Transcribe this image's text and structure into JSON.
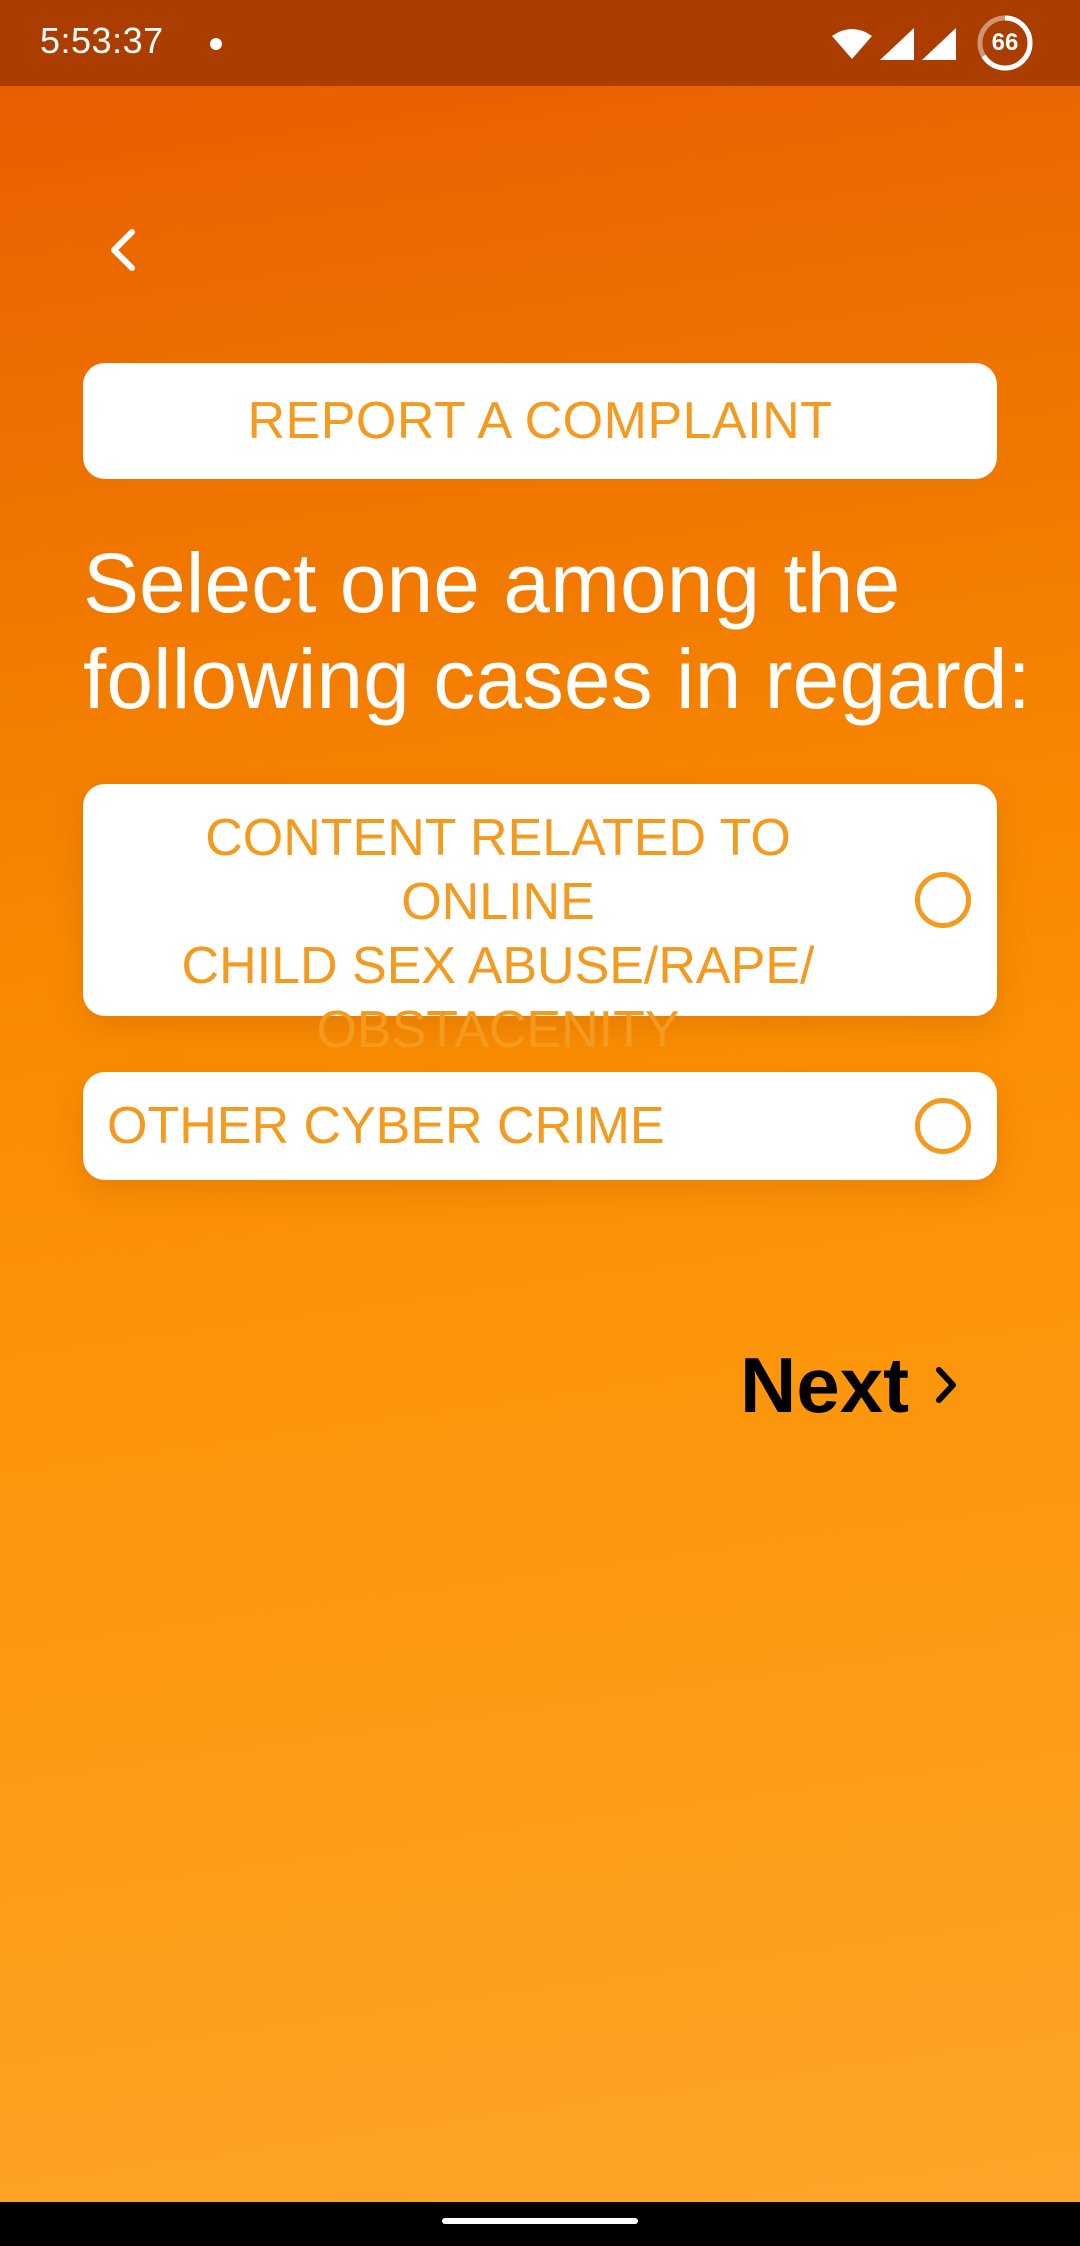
{
  "status_bar": {
    "time": "5:53:37",
    "battery": "66",
    "icons": [
      "notification-dot-icon",
      "wifi-icon",
      "signal-icon",
      "signal-icon",
      "battery-icon"
    ]
  },
  "header": {
    "back_icon": "chevron-left-icon",
    "title": "REPORT A COMPLAINT"
  },
  "prompt": {
    "line1": "Select one among the",
    "line2": "following cases in regard:"
  },
  "options": [
    {
      "lines": [
        "CONTENT RELATED TO ONLINE",
        "CHILD SEX ABUSE/RAPE/",
        "OBSTACENITY"
      ],
      "selected": false
    },
    {
      "label": "OTHER CYBER CRIME",
      "selected": false
    }
  ],
  "next": {
    "label": "Next",
    "icon": "chevron-right-icon"
  },
  "colors": {
    "accent_text": "#f39a1f",
    "gradient_top": "#e85a00",
    "gradient_bottom": "#fea52a",
    "status_bar": "#ab3d00"
  }
}
